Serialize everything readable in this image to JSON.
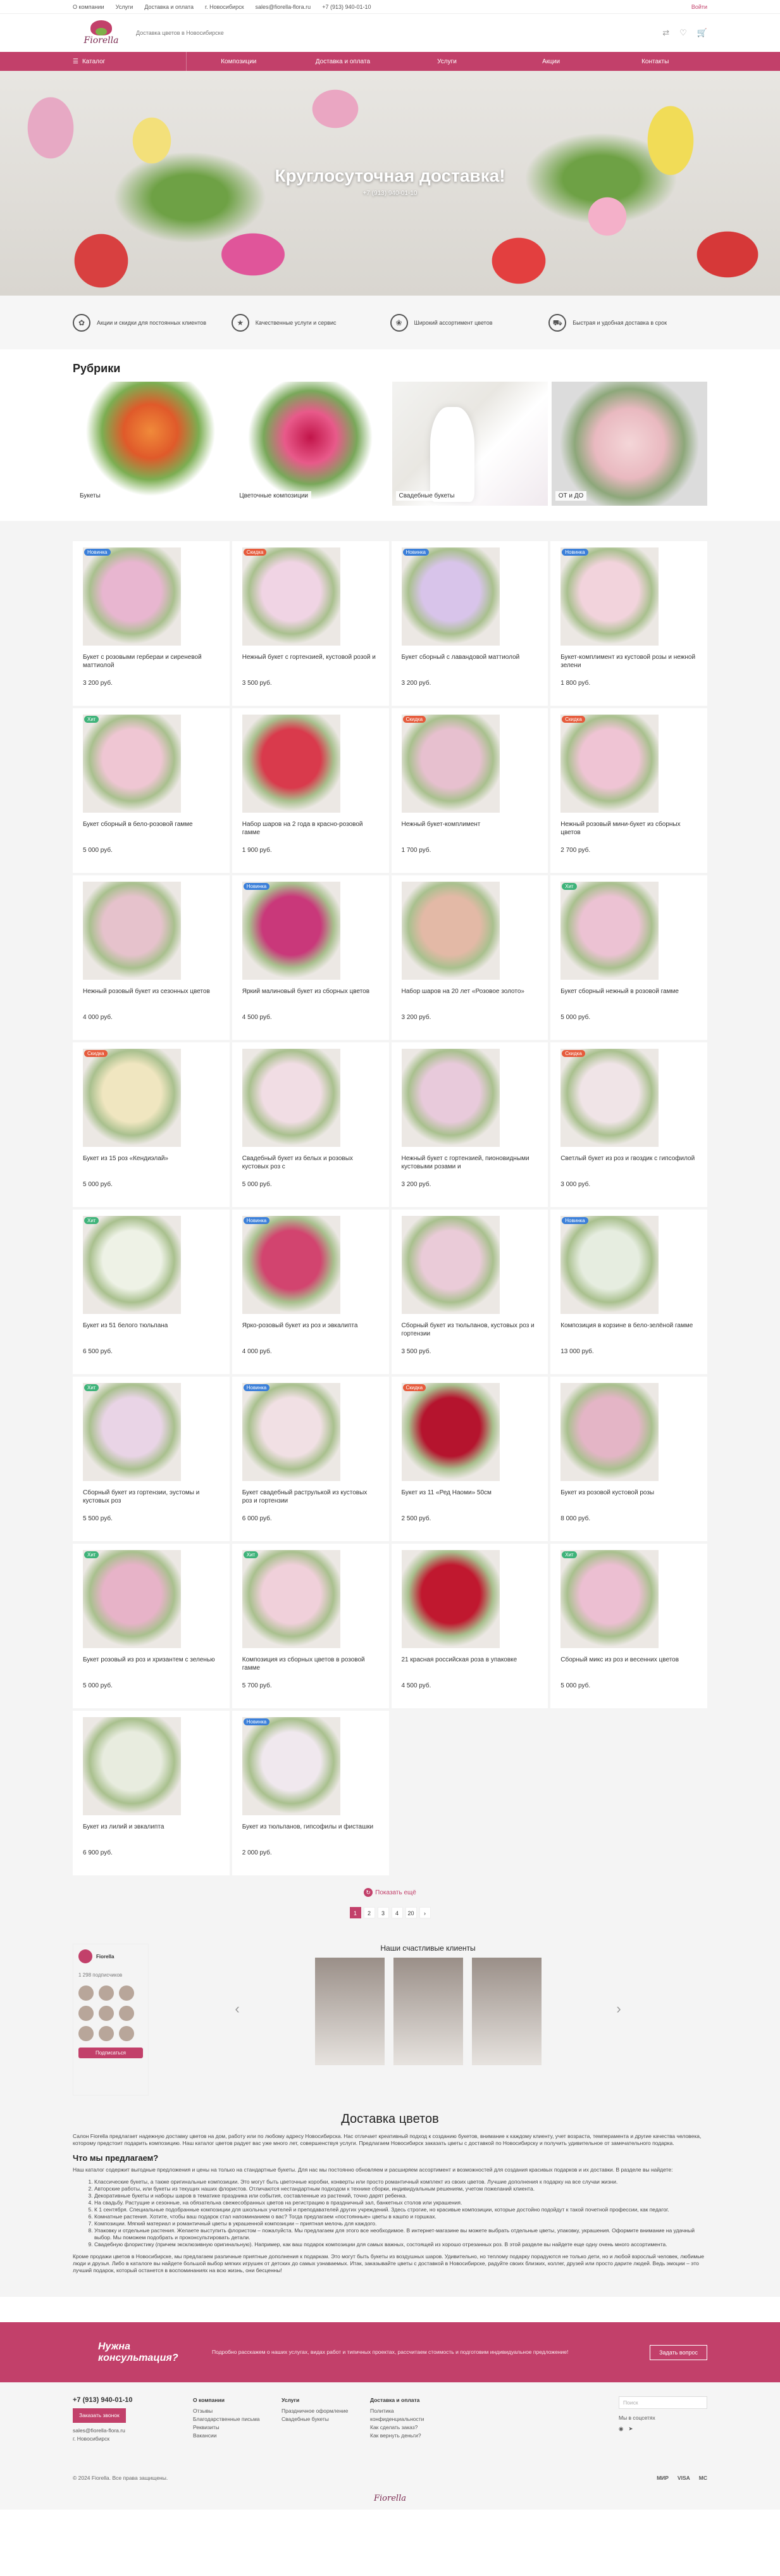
{
  "topbar": {
    "links": [
      "О компании",
      "Услуги",
      "Доставка и оплата",
      "г. Новосибирск",
      "sales@fiorella-flora.ru",
      "+7 (913) 940-01-10"
    ],
    "login": "Войти"
  },
  "header": {
    "logo_name": "Fiorella",
    "tagline": "Доставка цветов в Новосибирске"
  },
  "nav": {
    "catalog": "Каталог",
    "items": [
      "Композиции",
      "Доставка и оплата",
      "Услуги",
      "Акции",
      "Контакты"
    ]
  },
  "hero": {
    "title": "Круглосуточная доставка!",
    "subtitle": "+7 (913) 940-01-10"
  },
  "advantages": [
    {
      "icon": "gift-icon",
      "text": "Акции и скидки для постоянных клиентов"
    },
    {
      "icon": "quality-icon",
      "text": "Качественные услуги и сервис"
    },
    {
      "icon": "flower-icon",
      "text": "Широкий ассортимент цветов"
    },
    {
      "icon": "truck-icon",
      "text": "Быстрая и удобная доставка в срок"
    }
  ],
  "rubrics": {
    "title": "Рубрики",
    "items": [
      "Букеты",
      "Цветочные композиции",
      "Свадебные букеты",
      "ОТ и ДО"
    ]
  },
  "products": [
    {
      "name": "Букет с розовыми гербераи и сиреневой маттиолой",
      "price": "3 200 руб.",
      "badge": "Новинка",
      "bc": "#3b7fd9",
      "img": "#e8b6d0"
    },
    {
      "name": "Нежный букет с гортензией, кустовой розой и",
      "price": "3 500 руб.",
      "badge": "Скидка",
      "bc": "#e65b3c",
      "img": "#f0d4e4"
    },
    {
      "name": "Букет сборный с лавандовой маттиолой",
      "price": "3 200 руб.",
      "badge": "Новинка",
      "bc": "#3b7fd9",
      "img": "#d8c4ea"
    },
    {
      "name": "Букет-комплимент из кустовой розы и нежной зелени",
      "price": "1 800 руб.",
      "badge": "Новинка",
      "bc": "#3b7fd9",
      "img": "#f2d3dc"
    },
    {
      "name": "Букет сборный в бело-розовой гамме",
      "price": "5 000 руб.",
      "badge": "Хит",
      "bc": "#3fb37a",
      "img": "#efc6d3"
    },
    {
      "name": "Набор шаров на 2 года в красно-розовой гамме",
      "price": "1 900 руб.",
      "badge": "",
      "bc": "",
      "img": "#d93a4c"
    },
    {
      "name": "Нежный букет-комплимент",
      "price": "1 700 руб.",
      "badge": "Скидка",
      "bc": "#e65b3c",
      "img": "#e7c0cf"
    },
    {
      "name": "Нежный розовый мини-букет из сборных цветов",
      "price": "2 700 руб.",
      "badge": "Скидка",
      "bc": "#e65b3c",
      "img": "#efc4d4"
    },
    {
      "name": "Нежный розовый букет из сезонных цветов",
      "price": "4 000 руб.",
      "badge": "",
      "bc": "",
      "img": "#e6c2cc"
    },
    {
      "name": "Яркий малиновый букет из сборных цветов",
      "price": "4 500 руб.",
      "badge": "Новинка",
      "bc": "#3b7fd9",
      "img": "#c9387a"
    },
    {
      "name": "Набор шаров на 20 лет «Розовое золото»",
      "price": "3 200 руб.",
      "badge": "",
      "bc": "",
      "img": "#e3b9a6"
    },
    {
      "name": "Букет сборный нежный в розовой гамме",
      "price": "5 000 руб.",
      "badge": "Хит",
      "bc": "#3fb37a",
      "img": "#ecc2d3"
    },
    {
      "name": "Букет из 15 роз «Кендиэлай»",
      "price": "5 000 руб.",
      "badge": "Скидка",
      "bc": "#e65b3c",
      "img": "#f0e6c0"
    },
    {
      "name": "Свадебный букет из белых и розовых кустовых роз с",
      "price": "5 000 руб.",
      "badge": "",
      "bc": "",
      "img": "#f1dde4"
    },
    {
      "name": "Нежный букет с гортензией, пионовидными кустовыми розами и",
      "price": "3 200 руб.",
      "badge": "",
      "bc": "",
      "img": "#e8cadb"
    },
    {
      "name": "Светлый букет из роз и гвоздик с гипсофилой",
      "price": "3 000 руб.",
      "badge": "Скидка",
      "bc": "#e65b3c",
      "img": "#f0e4e7"
    },
    {
      "name": "Букет из 51 белого тюльпана",
      "price": "6 500 руб.",
      "badge": "Хит",
      "bc": "#3fb37a",
      "img": "#eef2e6"
    },
    {
      "name": "Яркo-розовый букет из роз и эвкалипта",
      "price": "4 000 руб.",
      "badge": "Новинка",
      "bc": "#3b7fd9",
      "img": "#d2446f"
    },
    {
      "name": "Сборный букет из тюльпанов, кустовых роз и гортензии",
      "price": "3 500 руб.",
      "badge": "",
      "bc": "",
      "img": "#eacbd8"
    },
    {
      "name": "Композиция в корзине в бело-зелёной гамме",
      "price": "13 000 руб.",
      "badge": "Новинка",
      "bc": "#3b7fd9",
      "img": "#e6ede0"
    },
    {
      "name": "Сборный букет из гортензии, эустомы и кустовых роз",
      "price": "5 500 руб.",
      "badge": "Хит",
      "bc": "#3fb37a",
      "img": "#e9d4e6"
    },
    {
      "name": "Букет свадебный раструлькой из кустовых роз и гортензии",
      "price": "6 000 руб.",
      "badge": "Новинка",
      "bc": "#3b7fd9",
      "img": "#f1e0e4"
    },
    {
      "name": "Букет из 11 «Ред Наоми» 50см",
      "price": "2 500 руб.",
      "badge": "Скидка",
      "bc": "#e65b3c",
      "img": "#b5142e"
    },
    {
      "name": "Букет из розовой кустовой розы",
      "price": "8 000 руб.",
      "badge": "",
      "bc": "",
      "img": "#e4b5c6"
    },
    {
      "name": "Букет розовый из роз и хризантем с зеленью",
      "price": "5 000 руб.",
      "badge": "Хит",
      "bc": "#3fb37a",
      "img": "#e7b3c8"
    },
    {
      "name": "Композиция из сборных цветов в розовой гамме",
      "price": "5 700 руб.",
      "badge": "Хит",
      "bc": "#3fb37a",
      "img": "#f0d0da"
    },
    {
      "name": "21 красная российская роза в упаковке",
      "price": "4 500 руб.",
      "badge": "",
      "bc": "",
      "img": "#c0182f"
    },
    {
      "name": "Сборный микс из роз и весенних цветов",
      "price": "5 000 руб.",
      "badge": "Хит",
      "bc": "#3fb37a",
      "img": "#ecbfd2"
    },
    {
      "name": "Букет из лилий и эвкалипта",
      "price": "6 900 руб.",
      "badge": "",
      "bc": "",
      "img": "#e8ecdf"
    },
    {
      "name": "Букет из тюльпанов, гипсофилы и фисташки",
      "price": "2 000 руб.",
      "badge": "Новинка",
      "bc": "#3b7fd9",
      "img": "#f0e8ee"
    }
  ],
  "more_label": "Показать ещё",
  "pager": [
    "1",
    "2",
    "3",
    "4",
    "20",
    "›"
  ],
  "vk": {
    "name": "Fiorella",
    "members": "1 298 подписчиков",
    "subscribe": "Подписаться"
  },
  "clients_title": "Наши счастливые клиенты",
  "delivery": {
    "title": "Доставка цветов",
    "p1": "Салон Fiorella предлагает надежную доставку цветов на дом, работу или по любому адресу Новосибирска. Нас отличает креативный подход к созданию букетов, внимание к каждому клиенту, учет возраста, темперамента и другие качества человека, которому предстоит подарить композицию. Наш каталог цветов радует вас уже много лет, совершенствуя услуги. Предлагаем Новосибирск заказать цветы с доставкой по Новосибирску и получить удивительное от замечательного подарка.",
    "h": "Что мы предлагаем?",
    "p2": "Наш каталог содержит выгодные предложения и цены на только на стандартные букеты. Для нас мы постоянно обновляем и расширяем ассортимент и возможностей для создания красивых подарков и их доставки. В разделе вы найдете:",
    "list": [
      "Классические букеты, а также оригинальные композиции. Это могут быть цветочные коробки, конверты или просто романтичный комплект из своих цветов. Лучшие дополнения к подарку на все случаи жизни.",
      "Авторские работы, или букеты из текущих наших флористов. Отличаются нестандартным подходом к технике сборки, индивидуальным решениям, учетом пожеланий клиента.",
      "Декоративные букеты и наборы шаров в тематике праздника или события, составленные из растений, точно дарят ребенка.",
      "На свадьбу. Растущие и сезонные, на обязательна свежесобранных цветов на регистрацию в праздничный зал, банкетных столов или украшения.",
      "К 1 сентября. Специальные подобранные композиции для школьных учителей и преподавателей других учреждений. Здесь строгие, но красивые композиции, которые достойно подойдут к такой почетной профессии, как педагог.",
      "Комнатные растения. Хотите, чтобы ваш подарок стал напоминанием о вас? Тогда предлагаем «постоянные» цветы в кашпо и горшках.",
      "Композиции. Мягкий материал и романтичный цветы в украшенной композиции – приятная мелочь для каждого.",
      "Упаковку и отдельные растения. Желаете выступить флористом – пожалуйста. Мы предлагаем для этого все необходимое. В интернет-магазине вы можете выбрать отдельные цветы, упаковку, украшения. Оформите внимание на удачный выбор. Мы поможем подобрать и проконсультировать детали.",
      "Свадебную флористику (причем эксклюзивную оригинальную). Например, как ваш подарок композиции для самых важных, состоящей из хорошо отрезанных роз. В этой разделе вы найдете еще одну очень много ассортимента."
    ],
    "p3": "Кроме продажи цветов в Новосибирске, мы предлагаем различные приятные дополнения к подаркам. Это могут быть букеты из воздушных шаров. Удивительно, но теплому подарку порадуются не только дети, но и любой взрослый человек, любимые люди и друзья. Либо в каталоге вы найдете большой выбор мягких игрушек от детских до самых узнаваемых. Итак, заказывайте цветы с доставкой в Новосибирске, радуйте своих близких, коллег, друзей или просто дарите людей. Ведь эмоции – это лучший подарок, который останется в воспоминаниях на всю жизнь, они бесценны!"
  },
  "consult": {
    "title": "Нужна консультация?",
    "text": "Подробно расскажем о наших услугах, видах работ и типичных проектах, рассчитаем стоимость и подготовим индивидуальное предложение!",
    "button": "Задать вопрос"
  },
  "footer": {
    "phone": "+7 (913) 940-01-10",
    "call": "Заказать звонок",
    "email": "sales@fiorella-flora.ru",
    "city": "г. Новосибирск",
    "cols": [
      {
        "h": "О компании",
        "items": [
          "Отзывы",
          "Благодарственные письма",
          "Реквизиты",
          "Вакансии"
        ]
      },
      {
        "h": "Услуги",
        "items": [
          "Праздничное оформление",
          "Свадебные букеты"
        ]
      },
      {
        "h": "Доставка и оплата",
        "items": [
          "Политика конфиденциальности",
          "Как сделать заказ?",
          "Как вернуть деньги?"
        ]
      }
    ],
    "search_ph": "Поиск",
    "social_title": "Мы в соцсетях",
    "copyright": "© 2024 Fiorella. Все права защищены.",
    "pay": [
      "МИР",
      "VISA",
      "MC"
    ]
  }
}
